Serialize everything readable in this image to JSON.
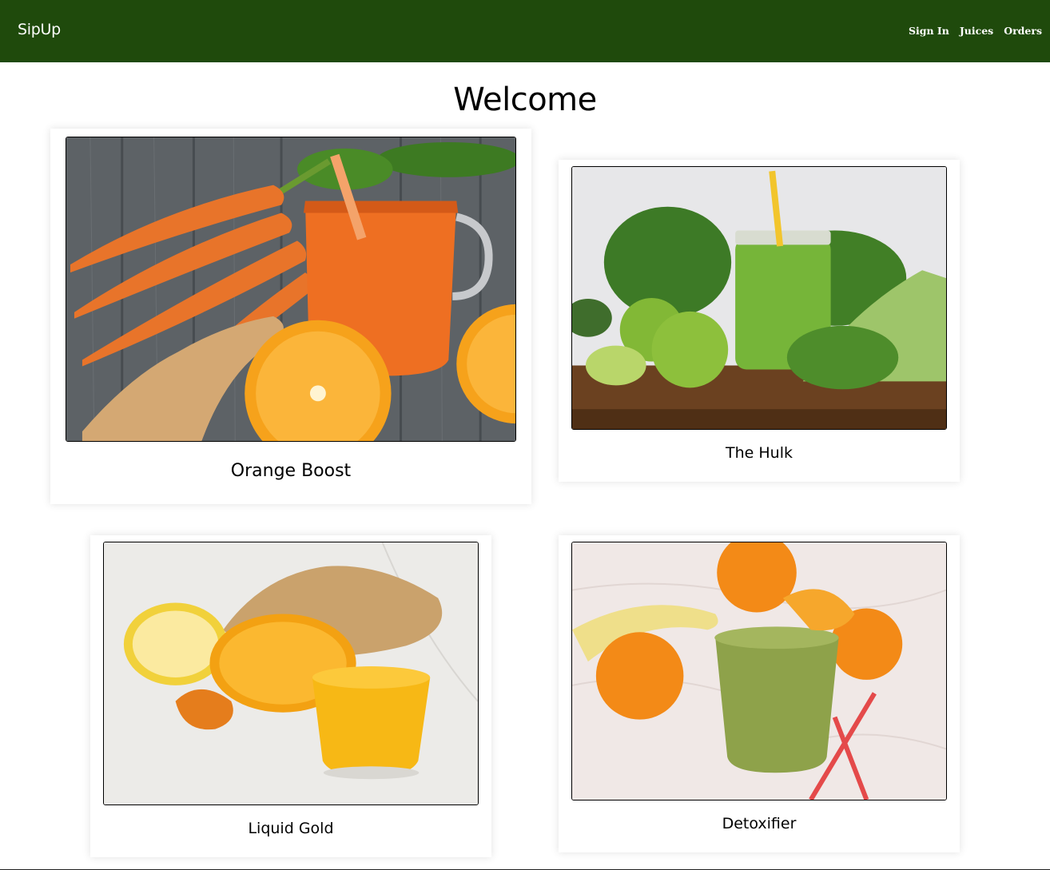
{
  "navbar": {
    "brand": "SipUp",
    "links": [
      {
        "label": "Sign In"
      },
      {
        "label": "Juices"
      },
      {
        "label": "Orders"
      }
    ],
    "background": "#1f4a0c"
  },
  "main": {
    "heading": "Welcome",
    "cards": [
      {
        "title": "Orange Boost",
        "image": "carrot-orange-ginger-juice-photo"
      },
      {
        "title": "The Hulk",
        "image": "green-apple-celery-juice-photo"
      },
      {
        "title": "Liquid Gold",
        "image": "lemon-orange-ginger-turmeric-photo"
      },
      {
        "title": "Detoxifier",
        "image": "green-smoothie-orange-banana-photo"
      }
    ]
  }
}
